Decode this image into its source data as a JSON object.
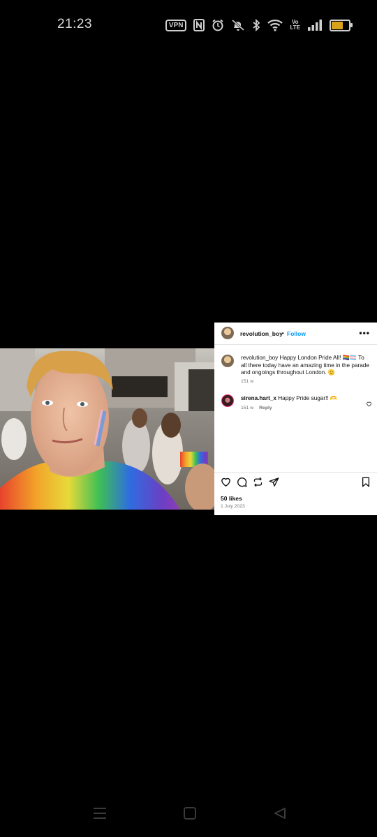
{
  "status_bar": {
    "time": "21:23",
    "vpn_label": "VPN",
    "volte_label_top": "Vo",
    "volte_label_bottom": "LTE",
    "icons": [
      "vpn-icon",
      "nfc-icon",
      "alarm-icon",
      "mute-icon",
      "bluetooth-icon",
      "wifi-icon",
      "volte-icon",
      "signal-icon",
      "battery-icon"
    ],
    "battery_level": 0.6,
    "battery_color": "#d9a21b"
  },
  "post": {
    "username": "revolution_boy",
    "separator": "•",
    "follow_label": "Follow",
    "more_icon": "more-horizontal-icon",
    "caption_username": "revolution_boy",
    "caption_text": "Happy London Pride All! 🏳️‍🌈🏳️‍⚧️ To all there today have an amazing time in the parade and ongoings throughout London. 🫡",
    "caption_age": "151 w",
    "comments": [
      {
        "username": "sirena.hart_x",
        "text": "Happy Pride sugar!! 🫶",
        "age": "151 w",
        "reply_label": "Reply"
      }
    ],
    "actions": [
      "heart-icon",
      "comment-icon",
      "repost-icon",
      "share-icon",
      "bookmark-icon"
    ],
    "likes": "50 likes",
    "date": "1 July 2023"
  },
  "nav_bar": {
    "buttons": [
      "recents-icon",
      "home-icon",
      "back-icon"
    ]
  },
  "colors": {
    "background": "#000000",
    "panel": "#ffffff",
    "link": "#0095f6",
    "muted": "#737373"
  }
}
